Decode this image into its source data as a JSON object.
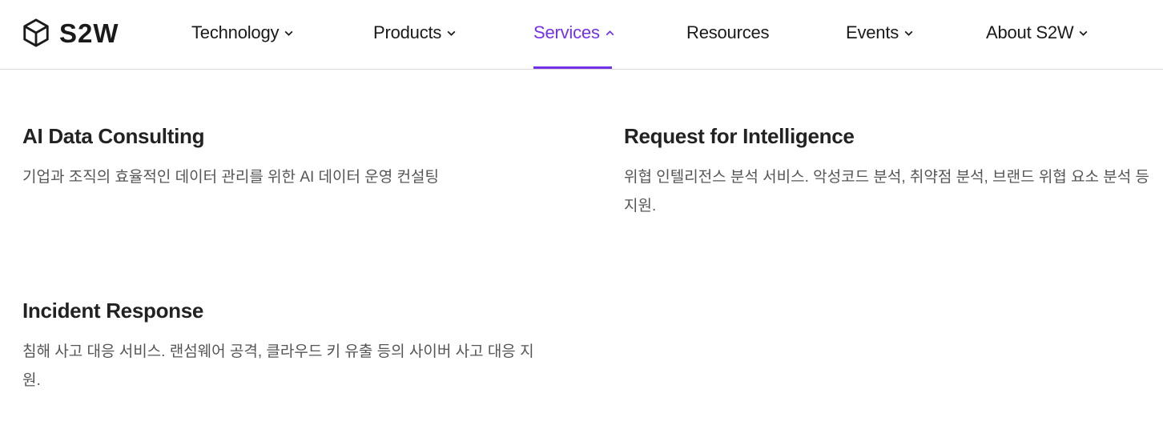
{
  "brand": {
    "name": "S2W",
    "icon": "cube-logo-icon"
  },
  "nav": {
    "items": [
      {
        "label": "Technology",
        "has_dropdown": true,
        "expanded": false
      },
      {
        "label": "Products",
        "has_dropdown": true,
        "expanded": false
      },
      {
        "label": "Services",
        "has_dropdown": true,
        "expanded": true,
        "active": true
      },
      {
        "label": "Resources",
        "has_dropdown": false
      },
      {
        "label": "Events",
        "has_dropdown": true,
        "expanded": false
      },
      {
        "label": "About S2W",
        "has_dropdown": true,
        "expanded": false
      }
    ],
    "active_color": "#7233e8"
  },
  "services_menu": {
    "items": [
      {
        "title": "AI Data Consulting",
        "description": "기업과 조직의 효율적인 데이터 관리를 위한 AI 데이터 운영 컨설팅"
      },
      {
        "title": "Request for Intelligence",
        "description": "위협 인텔리전스 분석 서비스. 악성코드 분석, 취약점 분석, 브랜드 위협 요소 분석 등 지원."
      },
      {
        "title": "Incident Response",
        "description": "침해 사고 대응 서비스. 랜섬웨어 공격, 클라우드 키 유출 등의 사이버 사고 대응 지원."
      }
    ]
  }
}
